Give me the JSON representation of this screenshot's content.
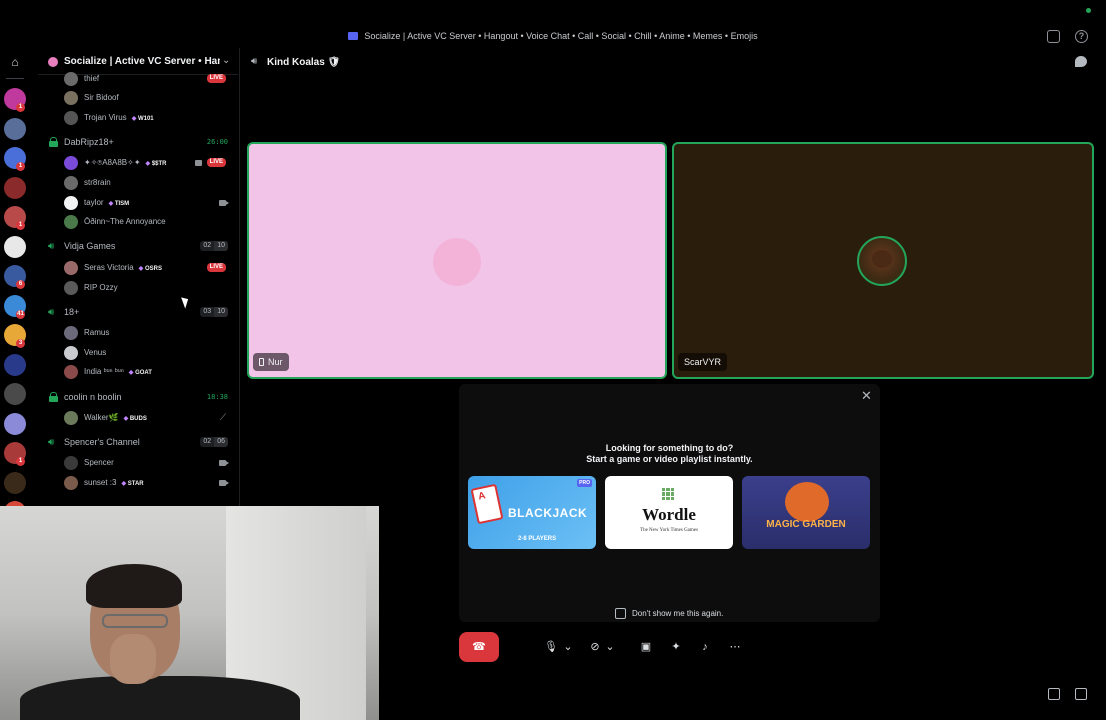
{
  "window": {
    "title": "Socialize | Active VC Server • Hangout • Voice Chat • Call • Social • Chill • Anime • Memes • Emojis"
  },
  "rail": {
    "home_icon": "discord-logo-icon",
    "servers": [
      {
        "color": "#c0399c",
        "badge": "1"
      },
      {
        "color": "#5a6e9a",
        "badge": ""
      },
      {
        "color": "#4a6fd8",
        "badge": "1"
      },
      {
        "color": "#8a2a2a",
        "badge": ""
      },
      {
        "color": "#b84a4a",
        "badge": "1"
      },
      {
        "color": "#e8e8e8",
        "badge": ""
      },
      {
        "color": "#3a5aa0",
        "badge": "6"
      },
      {
        "color": "#3a8ad8",
        "badge": "41"
      },
      {
        "color": "#e8a838",
        "badge": "3"
      },
      {
        "color": "#2a3a8a",
        "badge": ""
      },
      {
        "color": "#4a4a4a",
        "badge": ""
      },
      {
        "color": "#8a8ad8",
        "badge": ""
      },
      {
        "color": "#a83a3a",
        "badge": "1"
      },
      {
        "color": "#3a2a1a",
        "badge": ""
      },
      {
        "color": "#d8483a",
        "badge": ""
      }
    ]
  },
  "sidebar": {
    "guild_name": "Socialize | Active VC Server • Hang...",
    "channels": [
      {
        "name": "",
        "members": [
          {
            "name": "thief",
            "tag": "",
            "status": "live"
          },
          {
            "name": "Sir Bidoof",
            "tag": "",
            "status": ""
          },
          {
            "name": "Trojan Virus",
            "tag": "W101",
            "status": ""
          }
        ]
      },
      {
        "name": "DabRipz18+",
        "locked": true,
        "timer": "26:00",
        "members": [
          {
            "name": "✦✧⍟A8A8B✧✦",
            "tag": "$$TR",
            "status": "live-cam"
          },
          {
            "name": "str8rain",
            "tag": "",
            "status": ""
          },
          {
            "name": "taylor",
            "tag": "TISM",
            "status": "cam"
          },
          {
            "name": "Ōðinn~The Annoyance",
            "tag": "",
            "status": ""
          }
        ]
      },
      {
        "name": "Vidja Games",
        "count_a": "02",
        "count_b": "10",
        "members": [
          {
            "name": "Seras Victoria",
            "tag": "OSRS",
            "status": "live"
          },
          {
            "name": "RIP Ozzy",
            "tag": "",
            "status": ""
          }
        ]
      },
      {
        "name": "18+",
        "count_a": "03",
        "count_b": "10",
        "members": [
          {
            "name": "Ramus",
            "tag": "",
            "status": ""
          },
          {
            "name": "Venus",
            "tag": "",
            "status": ""
          },
          {
            "name": "India ᵇᵘⁿ ᵇᵘⁿ",
            "tag": "GOAT",
            "status": ""
          }
        ]
      },
      {
        "name": "coolin n boolin",
        "locked": true,
        "timer": "18:38",
        "members": [
          {
            "name": "Walker🌿",
            "tag": "BUDS",
            "status": "muted"
          }
        ]
      },
      {
        "name": "Spencer's Channel",
        "count_a": "02",
        "count_b": "06",
        "members": [
          {
            "name": "Spencer",
            "tag": "",
            "status": "cam"
          },
          {
            "name": "sunset :3",
            "tag": "STAR",
            "status": "cam"
          }
        ]
      }
    ]
  },
  "call": {
    "title": "Kind Koalas 🛡",
    "tiles": [
      {
        "label": "Nur",
        "bg": "#f2c4e8"
      },
      {
        "label": "ScarVYR",
        "bg": "#2a1d0c"
      }
    ]
  },
  "activity": {
    "title": "Looking for something to do?",
    "subtitle": "Start a game or video playlist instantly.",
    "cards": [
      {
        "name": "BLACKJACK",
        "sub": "2-8 PLAYERS",
        "badge": "PRO"
      },
      {
        "name": "Wordle",
        "sub": "The New York Times Games"
      },
      {
        "name": "MAGIC GARDEN"
      }
    ],
    "checkbox_label": "Don't show me this again."
  },
  "controls": {
    "buttons": [
      "microphone-icon",
      "chevron-down-icon",
      "camera-off-icon",
      "chevron-down-icon",
      "screen-share-icon",
      "activities-icon",
      "soundboard-icon",
      "more-icon"
    ],
    "hangup_icon": "phone-hangup-icon"
  },
  "colors": {
    "accent": "#5865f2",
    "speaking": "#23a55a",
    "live": "#da373c"
  }
}
